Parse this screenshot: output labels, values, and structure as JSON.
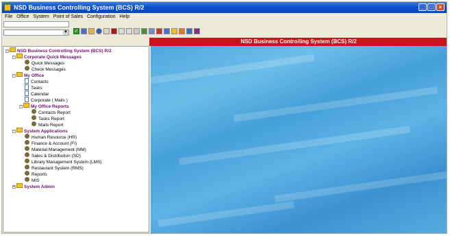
{
  "window": {
    "title": "NSD Business Controlling System (BCS) R/2"
  },
  "menu": [
    "File",
    "Office",
    "System",
    "Point of Sales",
    "Configuration",
    "Help"
  ],
  "banner": {
    "text": "NSD Business Controlling System (BCS) R/2"
  },
  "tree": {
    "root": "NSD Business Controlling System (BCS) R/2",
    "corporate_quick_messages": {
      "label": "Corporate Quick Messages",
      "items": [
        "Quick Messages",
        "Check Messages"
      ]
    },
    "my_office": {
      "label": "My Office",
      "items": [
        "Contacts",
        "Tasks",
        "Calendar",
        "Corporate ( Mails )"
      ]
    },
    "my_office_reports": {
      "label": "My Office Reports",
      "items": [
        "Contacts Report",
        "Tasks Report",
        "Mails Report"
      ]
    },
    "system_applications": {
      "label": "System Applications",
      "items": [
        "Human Resource (HR)",
        "Finance & Account (FI)",
        "Material Management (MM)",
        "Sales & Distribution (SD)",
        "Library Management System (LMS)",
        "Restaurant System (RMS)",
        "Reports",
        "MIS"
      ]
    },
    "system_admin": {
      "label": "System Admin"
    }
  },
  "colors": {
    "title_bar": "#0a4fd0",
    "banner": "#c8151b",
    "folder_text": "#6b0f6b",
    "content_background": "#4fa7de"
  },
  "icons": [
    "app-icon",
    "minimize-icon",
    "maximize-icon",
    "close-icon",
    "save-icon",
    "folder-icon",
    "gear-icon",
    "document-icon"
  ]
}
